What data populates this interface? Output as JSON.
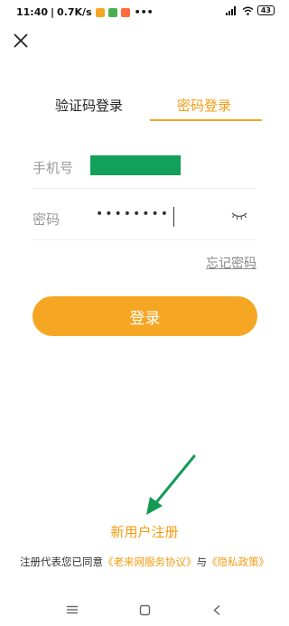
{
  "status_bar": {
    "time": "11:40",
    "speed": "0.7K/s",
    "dots": "•••",
    "battery": "43",
    "app_badge_colors": [
      "#f5a623",
      "#4caf50",
      "#ff6b3d"
    ]
  },
  "header": {
    "close_icon": "close-icon"
  },
  "tabs": [
    {
      "label": "验证码登录",
      "active": false
    },
    {
      "label": "密码登录",
      "active": true
    }
  ],
  "form": {
    "phone_label": "手机号",
    "password_label": "密码",
    "password_value": "••••••••",
    "eye_icon": "eye-closed-icon"
  },
  "forgot_password": "忘记密码",
  "login_button": "登录",
  "register_link": "新用户注册",
  "agreement": {
    "prefix": "注册代表您已同意",
    "terms": "《老来网服务协议》",
    "and": "与",
    "privacy": "《隐私政策》"
  },
  "colors": {
    "accent": "#f5a623",
    "mask": "#12a05a",
    "arrow": "#129a55"
  }
}
